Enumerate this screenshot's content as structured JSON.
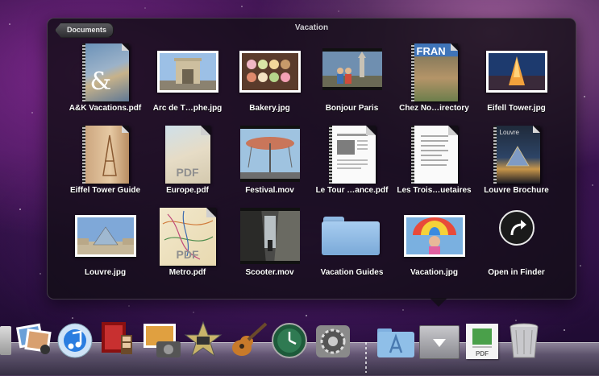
{
  "stack": {
    "title": "Vacation",
    "back_label": "Documents",
    "items": [
      {
        "label": "A&K Vacations.pdf"
      },
      {
        "label": "Arc de T…phe.jpg"
      },
      {
        "label": "Bakery.jpg"
      },
      {
        "label": "Bonjour Paris"
      },
      {
        "label": "Chez No…irectory"
      },
      {
        "label": "Eifell Tower.jpg"
      },
      {
        "label": "Eiffel Tower Guide"
      },
      {
        "label": "Europe.pdf"
      },
      {
        "label": "Festival.mov"
      },
      {
        "label": "Le Tour …ance.pdf"
      },
      {
        "label": "Les Trois…uetaires"
      },
      {
        "label": "Louvre Brochure"
      },
      {
        "label": "Louvre.jpg"
      },
      {
        "label": "Metro.pdf"
      },
      {
        "label": "Scooter.mov"
      },
      {
        "label": "Vacation Guides"
      },
      {
        "label": "Vacation.jpg"
      },
      {
        "label": "Open in Finder"
      }
    ],
    "pdf_badge": "PDF",
    "cover_text": {
      "ampersand": "&",
      "fran": "FRAN",
      "louvre": "Louvre"
    }
  },
  "dock": {
    "icons": [
      "iphoto-icon",
      "itunes-icon",
      "frontrow-icon",
      "photo-booth-icon",
      "image-capture-icon",
      "imovie-icon",
      "garageband-icon",
      "time-machine-icon",
      "system-preferences-icon",
      "applications-folder-icon",
      "vacation-stack-icon",
      "documents-stack-icon",
      "trash-icon"
    ],
    "pdf_badge": "PDF"
  },
  "colors": {
    "stack_bg": "#120e16",
    "label_text": "#ffffff",
    "folder_blue": "#8fb9e3"
  }
}
